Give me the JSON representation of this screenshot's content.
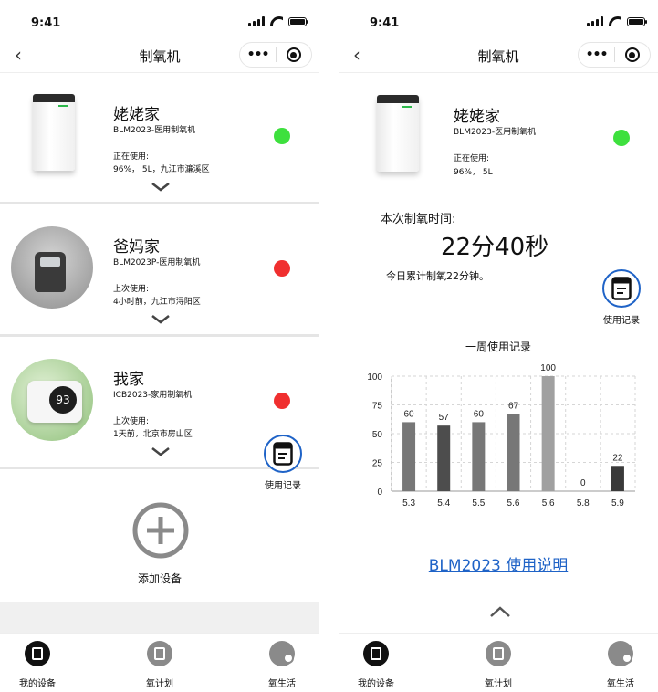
{
  "status_time": "9:41",
  "nav_title": "制氧机",
  "capsule_dots": "•••",
  "left": {
    "devices": [
      {
        "name": "姥姥家",
        "model": "BLM2023-医用制氧机",
        "use_label": "正在使用:",
        "use_info": "96%， 5L，九江市濂溪区",
        "status_color": "#3ee03e"
      },
      {
        "name": "爸妈家",
        "model": "BLM2023P-医用制氧机",
        "use_label": "上次使用:",
        "use_info": "4小时前，九江市浔阳区",
        "status_color": "#f02f2f"
      },
      {
        "name": "我家",
        "model": "ICB2023-家用制氧机",
        "use_label": "上次使用:",
        "use_info": "1天前，北京市房山区",
        "status_color": "#f02f2f"
      }
    ],
    "device3_screen": "93",
    "record_label": "使用记录",
    "add_label": "添加设备"
  },
  "right": {
    "name": "姥姥家",
    "model": "BLM2023-医用制氧机",
    "use_label": "正在使用:",
    "use_info": "96%， 5L",
    "status_color": "#3ee03e",
    "time_label": "本次制氧时间:",
    "time_value": "22分40秒",
    "today_text": "今日累计制氧22分钟。",
    "record_label": "使用记录",
    "manual_link": "BLM2023 使用说明"
  },
  "tabs": [
    {
      "label": "我的设备",
      "icon": "device-icon",
      "active": true
    },
    {
      "label": "氧计划",
      "icon": "plan-icon",
      "active": false
    },
    {
      "label": "氧生活",
      "icon": "life-icon",
      "active": false
    }
  ],
  "chart_data": {
    "type": "bar",
    "title": "一周使用记录",
    "categories": [
      "5.3",
      "5.4",
      "5.5",
      "5.6",
      "5.6",
      "5.8",
      "5.9"
    ],
    "values": [
      60,
      57,
      60,
      67,
      100,
      0,
      22
    ],
    "colors": [
      "#777777",
      "#4d4d4d",
      "#777777",
      "#777777",
      "#a0a0a0",
      "#777777",
      "#3a3a3a"
    ],
    "yticks": [
      0,
      25,
      50,
      75,
      100
    ],
    "ylim": [
      0,
      100
    ],
    "grid": true
  }
}
